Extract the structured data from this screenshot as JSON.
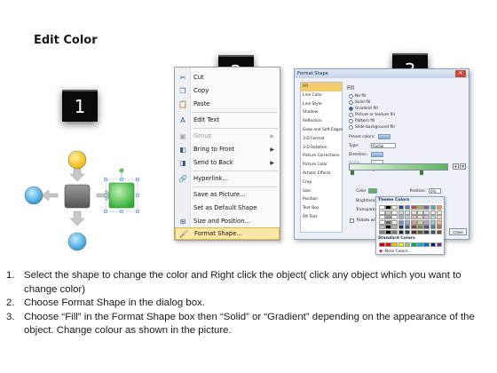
{
  "title": "Edit Color",
  "steps": [
    "1",
    "2",
    "3"
  ],
  "context_menu": {
    "items": [
      {
        "label": "Cut",
        "icon": "scissors-icon"
      },
      {
        "label": "Copy",
        "icon": "copy-icon"
      },
      {
        "label": "Paste",
        "icon": "paste-icon"
      },
      {
        "label": "Edit Text",
        "icon": "edit-text-icon"
      },
      {
        "label": "Group",
        "icon": "group-icon",
        "disabled": true
      },
      {
        "label": "Bring to Front",
        "icon": "bring-front-icon"
      },
      {
        "label": "Send to Back",
        "icon": "send-back-icon"
      },
      {
        "label": "Hyperlink...",
        "icon": "hyperlink-icon"
      },
      {
        "label": "Save as Picture...",
        "icon": ""
      },
      {
        "label": "Set as Default Shape",
        "icon": ""
      },
      {
        "label": "Size and Position...",
        "icon": "size-icon"
      },
      {
        "label": "Format Shape...",
        "icon": "format-shape-icon",
        "active": true
      }
    ]
  },
  "dialog": {
    "title": "Format Shape",
    "nav": [
      "Fill",
      "Line Color",
      "Line Style",
      "Shadow",
      "Reflection",
      "Glow and Soft Edges",
      "3-D Format",
      "3-D Rotation",
      "Picture Corrections",
      "Picture Color",
      "Artistic Effects",
      "Crop",
      "Size",
      "Position",
      "Text Box",
      "Alt Text"
    ],
    "fill_heading": "Fill",
    "fill_options": [
      "No fill",
      "Solid fill",
      "Gradient fill",
      "Picture or texture fill",
      "Pattern fill",
      "Slide background fill"
    ],
    "preset_label": "Preset colors:",
    "type_label": "Type:",
    "type_value": "Radial",
    "direction_label": "Direction:",
    "angle_label": "Angle:",
    "angle_value": "0°",
    "stops_label": "Gradient stops",
    "color_label": "Color",
    "position_label": "Position:",
    "position_value": "0%",
    "brightness_label": "Brightness:",
    "transparency_label": "Transparency:",
    "rotate_label": "Rotate with shape",
    "close_label": "Close"
  },
  "palette": {
    "theme_title": "Theme Colors",
    "standard_title": "Standard Colors",
    "more_label": "More Colors...",
    "theme_top": [
      "#ffffff",
      "#000000",
      "#eeece1",
      "#1f497d",
      "#4f81bd",
      "#c0504d",
      "#9bbb59",
      "#8064a2",
      "#4bacc6",
      "#f79646"
    ],
    "standard": [
      "#c00000",
      "#ff0000",
      "#ffc000",
      "#ffff00",
      "#92d050",
      "#00b050",
      "#00b0f0",
      "#0070c0",
      "#002060",
      "#7030a0"
    ]
  },
  "instructions": [
    {
      "num": "1.",
      "text": "Select the shape to change the color and Right click the object( click any object which you want to change color)"
    },
    {
      "num": "2.",
      "text": "Choose Format Shape in the dialog box."
    },
    {
      "num": "3.",
      "text": "Choose “Fill” in the Format Shape box then “Solid” or “Gradient” depending on the appearance of the object. Change colour as shown in the picture."
    }
  ]
}
